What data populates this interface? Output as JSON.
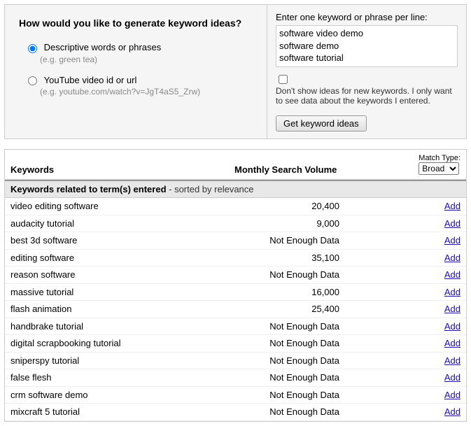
{
  "left": {
    "heading": "How would you like to generate keyword ideas?",
    "opt1_label": "Descriptive words or phrases",
    "opt1_hint": "(e.g. green tea)",
    "opt2_label": "YouTube video id or url",
    "opt2_hint": "(e.g. youtube.com/watch?v=JgT4aS5_Zrw)"
  },
  "right": {
    "enter_label": "Enter one keyword or phrase per line:",
    "textarea_value": "software video demo\nsoftware demo\nsoftware tutorial",
    "checkbox_label": "Don't show ideas for new keywords. I only want to see data about the keywords I entered.",
    "button_label": "Get keyword ideas"
  },
  "results": {
    "col_keywords": "Keywords",
    "col_volume": "Monthly Search Volume",
    "match_type_label": "Match Type:",
    "match_type_value": "Broad",
    "subhead_bold": "Keywords related to term(s) entered",
    "subhead_sort": " - sorted by relevance",
    "add_label": "Add",
    "rows": [
      {
        "kw": "video editing software",
        "vol": "20,400"
      },
      {
        "kw": "audacity tutorial",
        "vol": "9,000"
      },
      {
        "kw": "best 3d software",
        "vol": "Not Enough Data"
      },
      {
        "kw": "editing software",
        "vol": "35,100"
      },
      {
        "kw": "reason software",
        "vol": "Not Enough Data"
      },
      {
        "kw": "massive tutorial",
        "vol": "16,000"
      },
      {
        "kw": "flash animation",
        "vol": "25,400"
      },
      {
        "kw": "handbrake tutorial",
        "vol": "Not Enough Data"
      },
      {
        "kw": "digital scrapbooking tutorial",
        "vol": "Not Enough Data"
      },
      {
        "kw": "sniperspy tutorial",
        "vol": "Not Enough Data"
      },
      {
        "kw": "false flesh",
        "vol": "Not Enough Data"
      },
      {
        "kw": "crm software demo",
        "vol": "Not Enough Data"
      },
      {
        "kw": "mixcraft 5 tutorial",
        "vol": "Not Enough Data"
      }
    ]
  }
}
